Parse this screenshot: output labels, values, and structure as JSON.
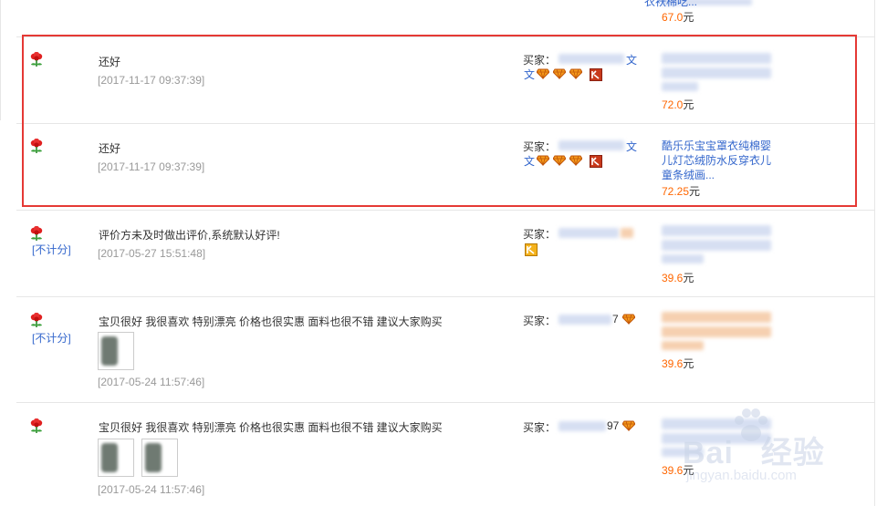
{
  "labels": {
    "buyer": "买家：",
    "unit": "元",
    "not_counted": "[不计分]"
  },
  "reviews": [
    {
      "product_fragment": "衣袄棉吃...",
      "price": "67.0"
    },
    {
      "comment": "还好",
      "date": "[2017-11-17 09:37:39]",
      "buyer_tail": "文",
      "buyer_tail2": "文",
      "price": "72.0"
    },
    {
      "comment": "还好",
      "date": "[2017-11-17 09:37:39]",
      "buyer_tail": "文",
      "buyer_tail2": "文",
      "product": "酷乐乐宝宝罩衣纯棉婴儿灯芯绒防水反穿衣儿童条绒画...",
      "price": "72.25"
    },
    {
      "comment": "评价方未及时做出评价,系统默认好评!",
      "date": "[2017-05-27 15:51:48]",
      "price": "39.6"
    },
    {
      "comment": "宝贝很好 我很喜欢 特别漂亮 价格也很实惠 面料也很不错 建议大家购买",
      "date": "[2017-05-24 11:57:46]",
      "buyer_tail": "7",
      "price": "39.6"
    },
    {
      "comment": "宝贝很好 我很喜欢 特别漂亮 价格也很实惠 面料也很不错 建议大家购买",
      "date": "[2017-05-24 11:57:46]",
      "buyer_tail": "97",
      "price": "39.6"
    }
  ],
  "watermark": {
    "brand": "Bai",
    "brand2": "经验",
    "url": "jingyan.baidu.com"
  },
  "colors": {
    "link": "#3366cc",
    "price": "#ff6600",
    "date": "#999999",
    "highlight": "#e53935"
  },
  "icons": [
    "red-flower-icon",
    "diamond-icon",
    "vip-badge-icon",
    "baidu-paw-icon"
  ]
}
